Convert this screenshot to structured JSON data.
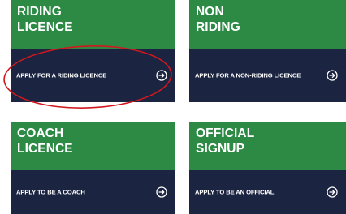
{
  "cards": [
    {
      "title_line1": "RIDING",
      "title_line2": "LICENCE",
      "link_label": "APPLY FOR A RIDING LICENCE",
      "icon": "arrow-circle-right-icon"
    },
    {
      "title_line1": "NON",
      "title_line2": "RIDING",
      "link_label": "APPLY FOR A NON-RIDING LICENCE",
      "icon": "arrow-circle-right-icon"
    },
    {
      "title_line1": "COACH",
      "title_line2": "LICENCE",
      "link_label": "APPLY TO BE A COACH",
      "icon": "arrow-circle-right-icon"
    },
    {
      "title_line1": "OFFICIAL",
      "title_line2": "SIGNUP",
      "link_label": "APPLY TO BE AN OFFICIAL",
      "icon": "arrow-circle-right-icon"
    }
  ],
  "colors": {
    "card_header": "#2d8a45",
    "card_body": "#1b2440",
    "annotation_ellipse": "#d0181e",
    "text": "#ffffff"
  }
}
